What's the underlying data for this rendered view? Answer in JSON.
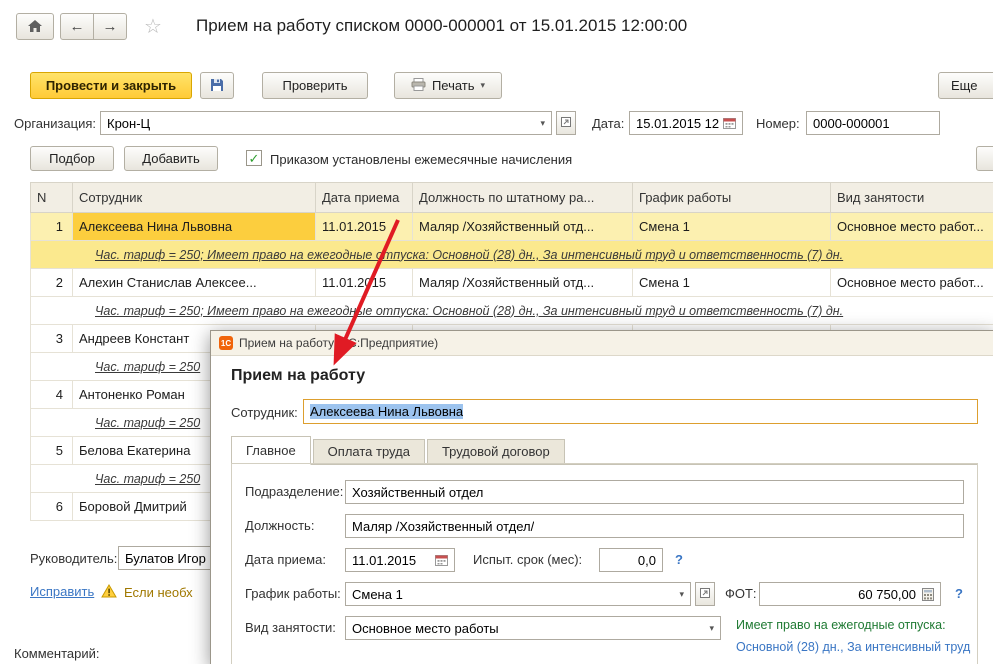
{
  "titlebar": {
    "title": "Прием на работу списком 0000-000001 от 15.01.2015 12:00:00"
  },
  "toolbar": {
    "post_and_close": "Провести и закрыть",
    "check": "Проверить",
    "print": "Печать",
    "more": "Еще"
  },
  "doc_form": {
    "org_label": "Организация:",
    "org_value": "Крон-Ц",
    "date_label": "Дата:",
    "date_value": "15.01.2015 12",
    "number_label": "Номер:",
    "number_value": "0000-000001",
    "pick_button": "Подбор",
    "add_button": "Добавить",
    "order_checkbox_label": "Приказом установлены ежемесячные начисления",
    "manager_label": "Руководитель:",
    "manager_value": "Булатов Игор",
    "fix_link": "Исправить",
    "warning_text": "Если необх",
    "comment_label": "Комментарий:"
  },
  "table": {
    "headers": [
      "N",
      "Сотрудник",
      "Дата приема",
      "Должность по штатному ра...",
      "График работы",
      "Вид занятости"
    ],
    "rows": [
      {
        "n": "1",
        "employee": "Алексеева Нина Львовна",
        "hire_date": "11.01.2015",
        "position": "Маляр /Хозяйственный отд...",
        "schedule": "Смена 1",
        "employment": "Основное место работ...",
        "detail": "Час. тариф = 250; Имеет право на ежегодные отпуска: Основной (28) дн., За интенсивный труд и ответственность (7) дн."
      },
      {
        "n": "2",
        "employee": "Алехин Станислав Алексее...",
        "hire_date": "11.01.2015",
        "position": "Маляр /Хозяйственный отд...",
        "schedule": "Смена 1",
        "employment": "Основное место работ...",
        "detail": "Час. тариф = 250; Имеет право на ежегодные отпуска: Основной (28) дн., За интенсивный труд и ответственность (7) дн."
      },
      {
        "n": "3",
        "employee": "Андреев Констант",
        "detail": "Час. тариф = 250"
      },
      {
        "n": "4",
        "employee": "Антоненко Роман",
        "detail": "Час. тариф = 250"
      },
      {
        "n": "5",
        "employee": "Белова Екатерина",
        "detail": "Час. тариф = 250"
      },
      {
        "n": "6",
        "employee": "Боровой Дмитрий"
      }
    ]
  },
  "dialog": {
    "window_title": "Прием на работу  (1С:Предприятие)",
    "logo_text": "1С",
    "heading": "Прием на работу",
    "employee_label": "Сотрудник:",
    "employee_value": "Алексеева Нина Львовна",
    "tabs": [
      {
        "label": "Главное"
      },
      {
        "label": "Оплата труда"
      },
      {
        "label": "Трудовой договор"
      }
    ],
    "department_label": "Подразделение:",
    "department_value": "Хозяйственный отдел",
    "position_label": "Должность:",
    "position_value": "Маляр /Хозяйственный отдел/",
    "hire_date_label": "Дата приема:",
    "hire_date_value": "11.01.2015",
    "probation_label": "Испыт. срок (мес):",
    "probation_value": "0,0",
    "schedule_label": "График работы:",
    "schedule_value": "Смена 1",
    "fot_label": "ФОТ:",
    "fot_value": "60 750,00",
    "employment_label": "Вид занятости:",
    "employment_value": "Основное место работы",
    "vacation_text": "Имеет право на ежегодные отпуска:",
    "vacation_link": "Основной (28) дн., За интенсивный труд",
    "help": "?"
  },
  "colors": {
    "primary_button": "#ffcb37",
    "selected_cell": "#fcce3e",
    "selected_row": "#fcf0b0",
    "link": "#3a76c4",
    "warning_text": "#a07800",
    "vacation_green": "#1f7a33",
    "arrow_red": "#e01b24"
  }
}
